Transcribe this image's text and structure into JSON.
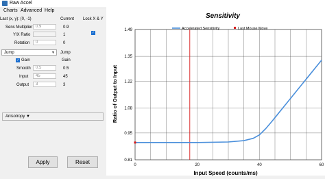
{
  "window": {
    "title": "Raw Accel"
  },
  "menu": [
    "Charts",
    "Advanced",
    "Help"
  ],
  "header": {
    "last_xy": "Last (x, y): (0, -1)",
    "current": "Current",
    "lock_xy": "Lock X & Y"
  },
  "settings": [
    {
      "label": "Sens Multiplier",
      "value": "0.9",
      "current": "0.9"
    },
    {
      "label": "Y/X Ratio",
      "value": "",
      "current": "1"
    },
    {
      "label": "Rotation",
      "value": "0",
      "current": "0"
    }
  ],
  "accel": {
    "mode": "Jump",
    "mode_current": "Jump",
    "gain_label": "Gain",
    "gain_current": "Gain",
    "params": [
      {
        "label": "Smooth",
        "value": "0.5",
        "current": "0.5"
      },
      {
        "label": "Input",
        "value": "45",
        "current": "45"
      },
      {
        "label": "Output",
        "value": "3",
        "current": "3"
      }
    ]
  },
  "anisotropy": {
    "label": "Anisotropy ▼"
  },
  "buttons": {
    "apply": "Apply",
    "reset": "Reset"
  },
  "colors": {
    "curve": "#4a8fdb",
    "marker": "#d81b1b",
    "checkbox": "#1b6fd0"
  },
  "chart_data": {
    "type": "line",
    "title": "Sensitivity",
    "xlabel": "Input Speed (counts/ms)",
    "ylabel": "Ratio of Output to Input",
    "xlim": [
      0,
      60
    ],
    "ylim": [
      0.81,
      1.49
    ],
    "x_ticks": [
      "0",
      "20",
      "40",
      "60"
    ],
    "y_ticks": [
      "0.81",
      "0.95",
      "1.08",
      "1.22",
      "1.35",
      "1.49"
    ],
    "legend": [
      "Accelerated Sensitivity",
      "Last Mouse Move"
    ],
    "legend_position": "top-center",
    "grid": true,
    "series": [
      {
        "name": "Accelerated Sensitivity",
        "x": [
          0,
          10,
          20,
          30,
          35,
          38,
          40,
          42,
          44,
          46,
          48,
          50,
          52,
          54,
          56,
          58,
          60
        ],
        "y": [
          0.9,
          0.9,
          0.9,
          0.903,
          0.91,
          0.922,
          0.94,
          0.972,
          1.01,
          1.05,
          1.09,
          1.13,
          1.17,
          1.21,
          1.25,
          1.29,
          1.33
        ]
      },
      {
        "name": "Last Mouse Move",
        "x": [
          0
        ],
        "y": [
          0.9
        ]
      }
    ],
    "reference_line": {
      "x": 17.6
    }
  }
}
